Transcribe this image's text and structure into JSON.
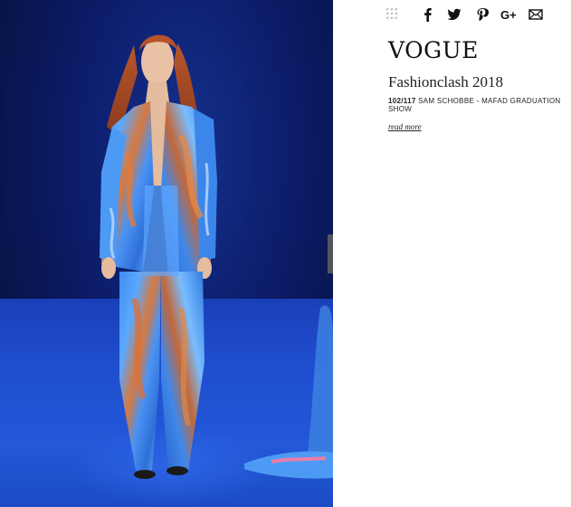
{
  "share_bar": {
    "icons": [
      "grid-icon",
      "facebook-icon",
      "twitter-icon",
      "pinterest-icon",
      "google-plus-icon",
      "mail-icon"
    ]
  },
  "brand": {
    "logo_text": "VOGUE"
  },
  "gallery": {
    "title": "Fashionclash 2018",
    "counter": "102/117",
    "caption": "SAM SCHOBBE - MAFAD GRADUATION SHOW",
    "read_more": "read more",
    "next_icon": "arrow-right-icon"
  },
  "colors": {
    "backdrop": "#0c1d6b",
    "runway": "#2358d8",
    "arrow_bg": "#5f5f5f",
    "text": "#111111"
  }
}
